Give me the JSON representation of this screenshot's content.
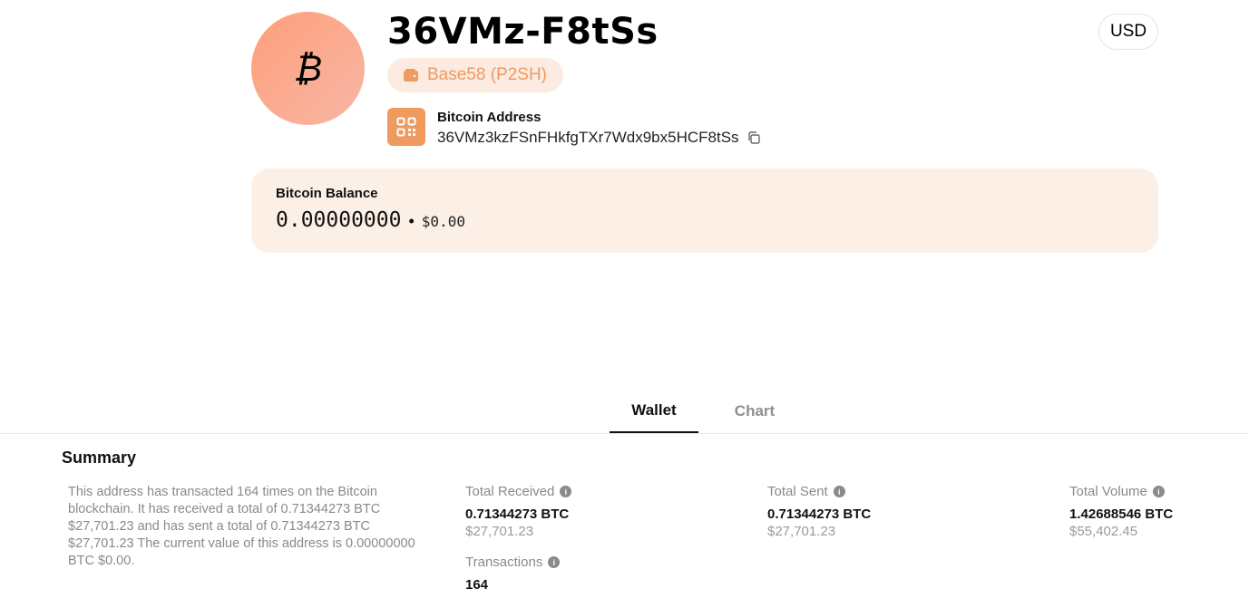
{
  "header": {
    "title": "36VMz-F8tSs",
    "avatar_glyph": "₿",
    "type_badge": "Base58 (P2SH)",
    "currency": "USD",
    "address_label": "Bitcoin Address",
    "address": "36VMz3kzFSnFHkfgTXr7Wdx9bx5HCF8tSs"
  },
  "balance": {
    "label": "Bitcoin Balance",
    "btc": "0.00000000",
    "separator": "•",
    "usd": "$0.00"
  },
  "tabs": [
    {
      "label": "Wallet",
      "active": true
    },
    {
      "label": "Chart",
      "active": false
    }
  ],
  "summary": {
    "title": "Summary",
    "description": "This address has transacted 164 times on the Bitcoin blockchain. It has received a total of 0.71344273 BTC $27,701.23 and has sent a total of 0.71344273 BTC $27,701.23 The current value of this address is 0.00000000 BTC $0.00.",
    "total_received": {
      "label": "Total Received",
      "btc": "0.71344273 BTC",
      "usd": "$27,701.23"
    },
    "total_sent": {
      "label": "Total Sent",
      "btc": "0.71344273 BTC",
      "usd": "$27,701.23"
    },
    "total_volume": {
      "label": "Total Volume",
      "btc": "1.42688546 BTC",
      "usd": "$55,402.45"
    },
    "transactions": {
      "label": "Transactions",
      "value": "164"
    }
  },
  "colors": {
    "accent": "#ef9a5f",
    "badge_bg": "#fcebe1",
    "card_bg": "#fcefe6"
  }
}
